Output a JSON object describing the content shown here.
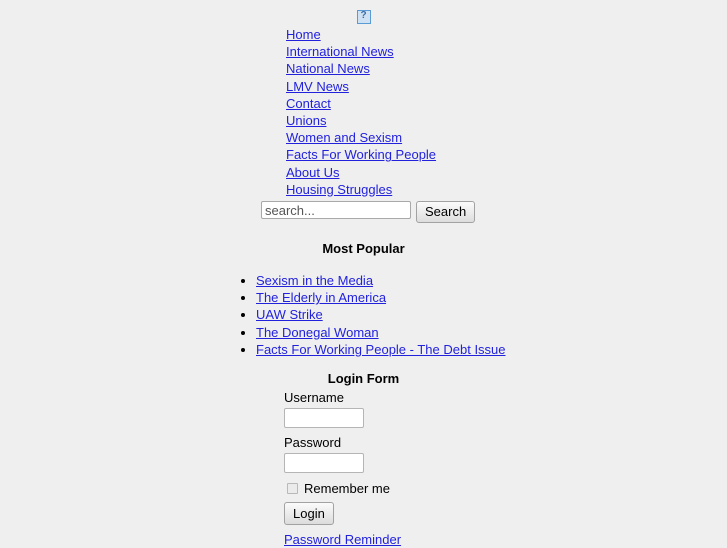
{
  "page": {
    "background_color": "#efefef",
    "link_color": "#2222dd",
    "text_color": "#000000"
  },
  "header": {
    "logo": {
      "icon": "broken-image-icon",
      "glyph": "?",
      "alt": ""
    }
  },
  "nav": {
    "items": [
      {
        "label": "Home"
      },
      {
        "label": "International News"
      },
      {
        "label": "National News"
      },
      {
        "label": "LMV News"
      },
      {
        "label": "Contact"
      },
      {
        "label": "Unions"
      },
      {
        "label": "Women and Sexism"
      },
      {
        "label": "Facts For Working People"
      },
      {
        "label": "About Us"
      },
      {
        "label": "Housing Struggles"
      }
    ]
  },
  "search": {
    "value": "",
    "placeholder": "search...",
    "button_label": "Search"
  },
  "most_popular": {
    "title": "Most Popular",
    "items": [
      {
        "label": "Sexism in the Media"
      },
      {
        "label": "The Elderly in America"
      },
      {
        "label": "UAW Strike"
      },
      {
        "label": "The Donegal Woman"
      },
      {
        "label": "Facts For Working People - The Debt Issue"
      }
    ]
  },
  "login_form": {
    "title": "Login Form",
    "username_label": "Username",
    "username_value": "",
    "password_label": "Password",
    "password_value": "",
    "remember_label": "Remember me",
    "remember_checked": false,
    "submit_label": "Login",
    "links": [
      {
        "label": "Password Reminder"
      }
    ]
  }
}
